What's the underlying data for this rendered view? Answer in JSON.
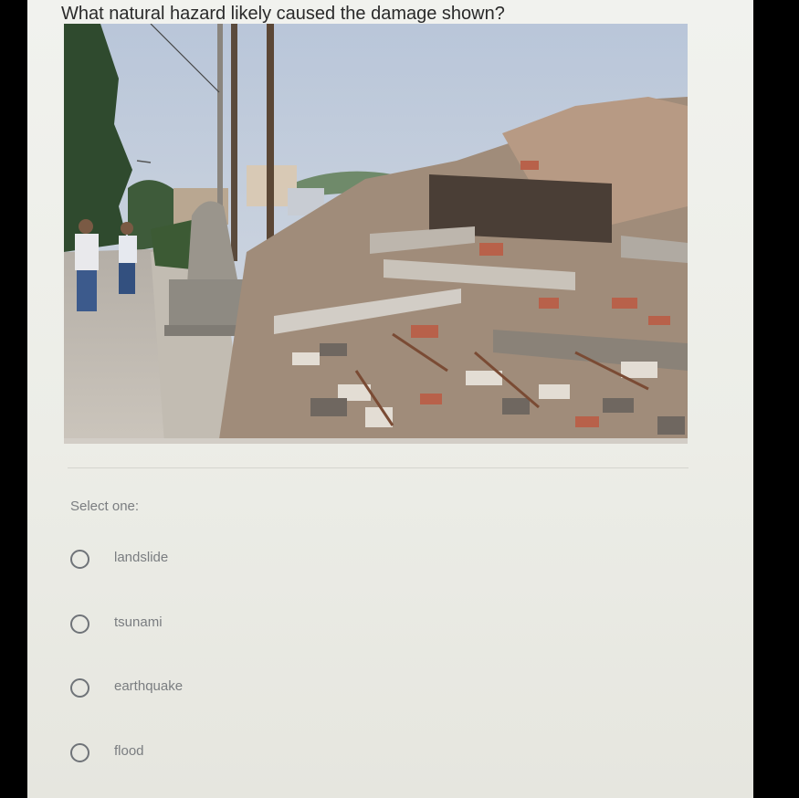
{
  "question": {
    "text": "What natural hazard likely caused the damage shown?"
  },
  "image": {
    "description": "collapsed-building-rubble-photo"
  },
  "prompt": {
    "select_label": "Select one:"
  },
  "options": [
    {
      "label": "landslide"
    },
    {
      "label": "tsunami"
    },
    {
      "label": "earthquake"
    },
    {
      "label": "flood"
    }
  ],
  "colors": {
    "text": "#2a2a2a",
    "muted": "#7a7d80",
    "background": "#eeefea"
  }
}
